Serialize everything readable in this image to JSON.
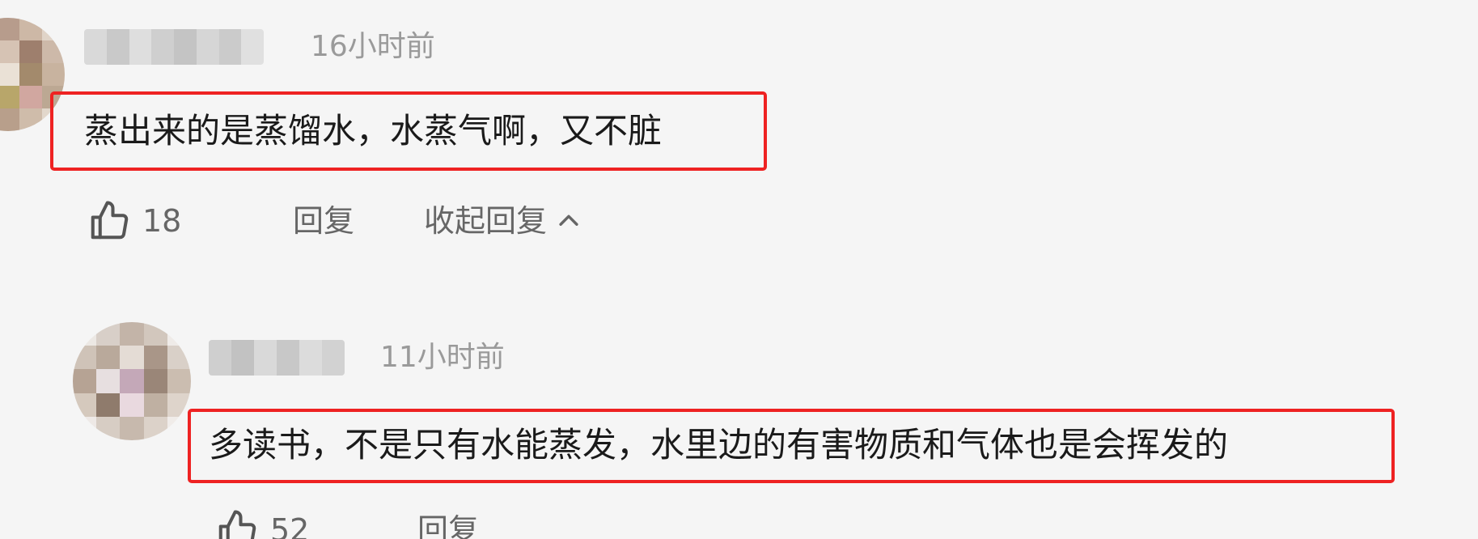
{
  "comments": [
    {
      "timestamp": "16小时前",
      "text": "蒸出来的是蒸馏水，水蒸气啊，又不脏",
      "likes": "18",
      "reply_label": "回复",
      "collapse_label": "收起回复"
    },
    {
      "timestamp": "11小时前",
      "text": "多读书，不是只有水能蒸发，水里边的有害物质和气体也是会挥发的",
      "likes": "52",
      "reply_label": "回复"
    }
  ],
  "colors": {
    "background": "#f5f5f5",
    "highlight_border": "#ee2222",
    "timestamp": "#9a9a9a",
    "action_text": "#666666",
    "comment_text": "#1a1a1a"
  },
  "icons": {
    "like": "thumbs-up-icon",
    "collapse": "chevron-up-icon"
  }
}
